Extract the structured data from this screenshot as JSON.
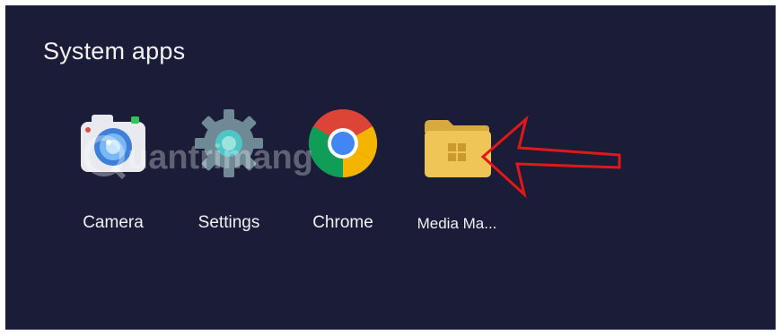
{
  "section": {
    "title": "System apps"
  },
  "apps": [
    {
      "label": "Camera",
      "icon": "camera-icon"
    },
    {
      "label": "Settings",
      "icon": "settings-gear-icon"
    },
    {
      "label": "Chrome",
      "icon": "chrome-icon"
    },
    {
      "label": "Media Ma...",
      "icon": "media-manager-folder-icon"
    }
  ],
  "annotation": {
    "arrow_color": "#e01818",
    "points_to": "Media Ma..."
  },
  "watermark": {
    "text": "uantrimang"
  },
  "colors": {
    "background": "#1b1d38",
    "folder": "#f0c557",
    "arrow": "#e01818"
  }
}
